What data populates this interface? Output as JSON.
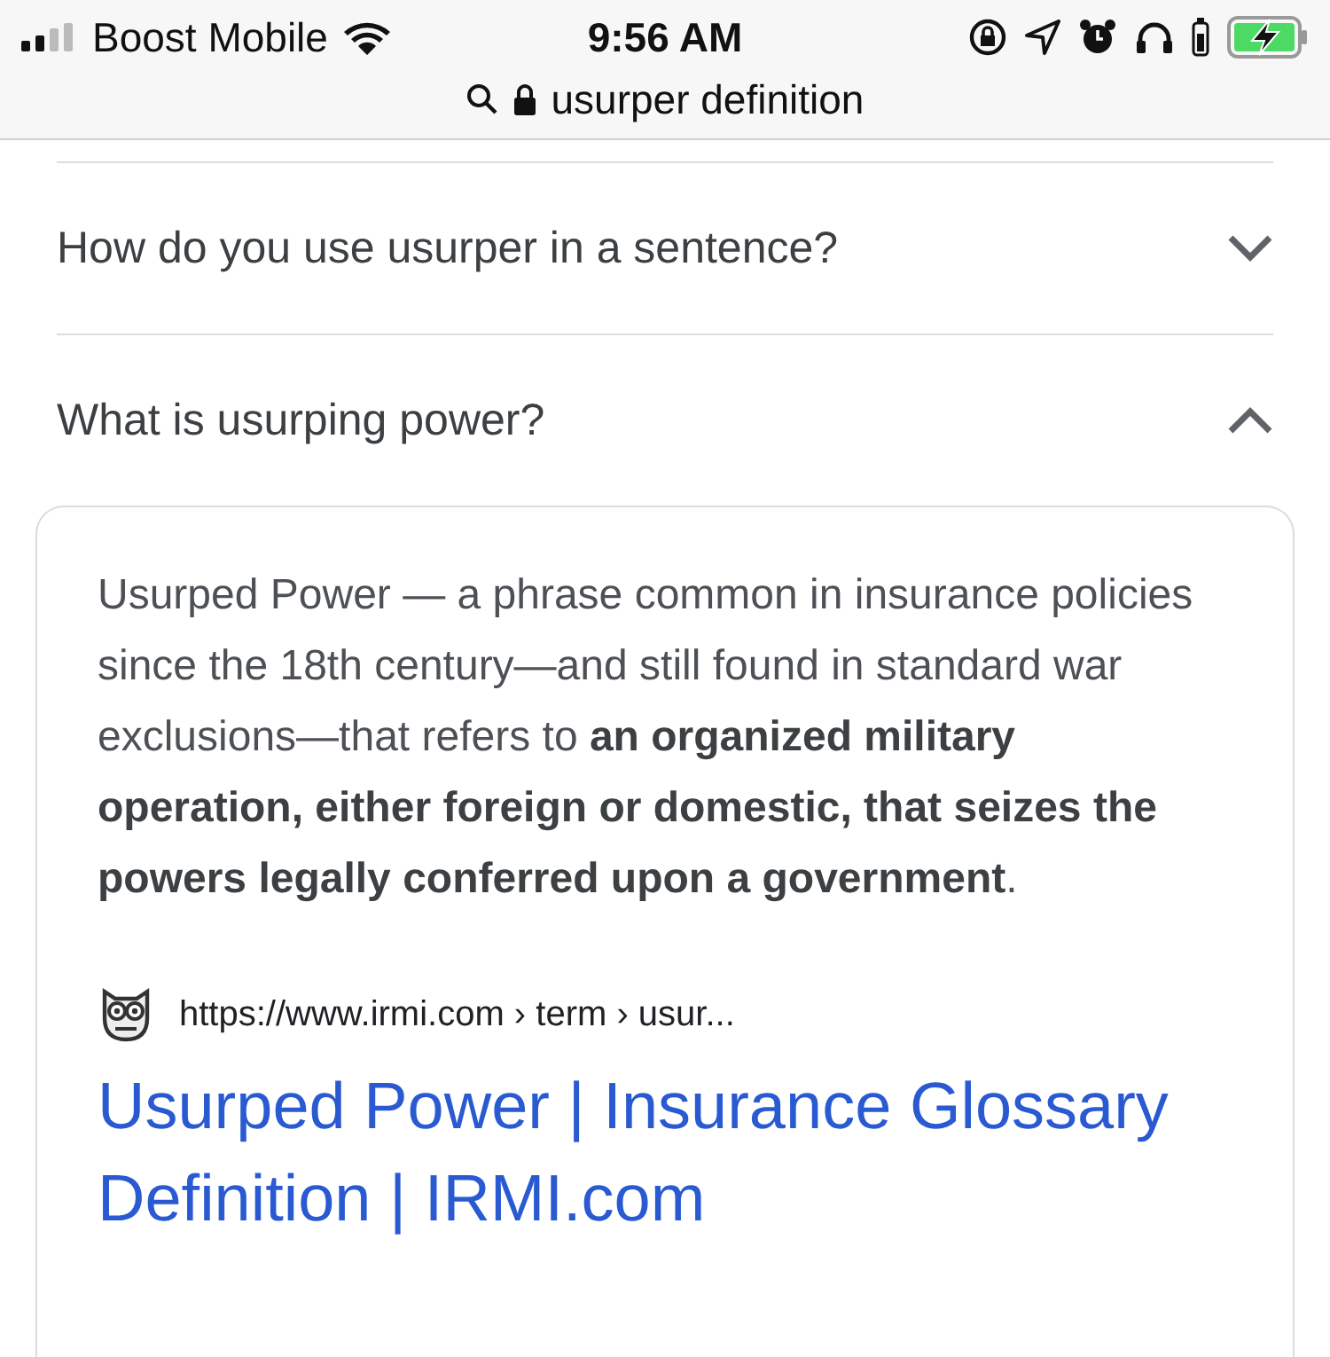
{
  "status_bar": {
    "carrier": "Boost Mobile",
    "time": "9:56 AM"
  },
  "address_bar": {
    "text": "usurper definition"
  },
  "questions": [
    {
      "text": "How do you use usurper in a sentence?",
      "expanded": false
    },
    {
      "text": "What is usurping power?",
      "expanded": true
    }
  ],
  "answer": {
    "text": "Usurped Power — a phrase common in insurance policies since the 18th century—and still found in standard war exclusions—that refers to **an organized military operation, either foreign or domestic, that seizes the powers legally conferred upon a government**.",
    "source_url": "https://www.irmi.com › term › usur...",
    "link_title": "Usurped Power | Insurance Glossary Definition | IRMI.com"
  }
}
